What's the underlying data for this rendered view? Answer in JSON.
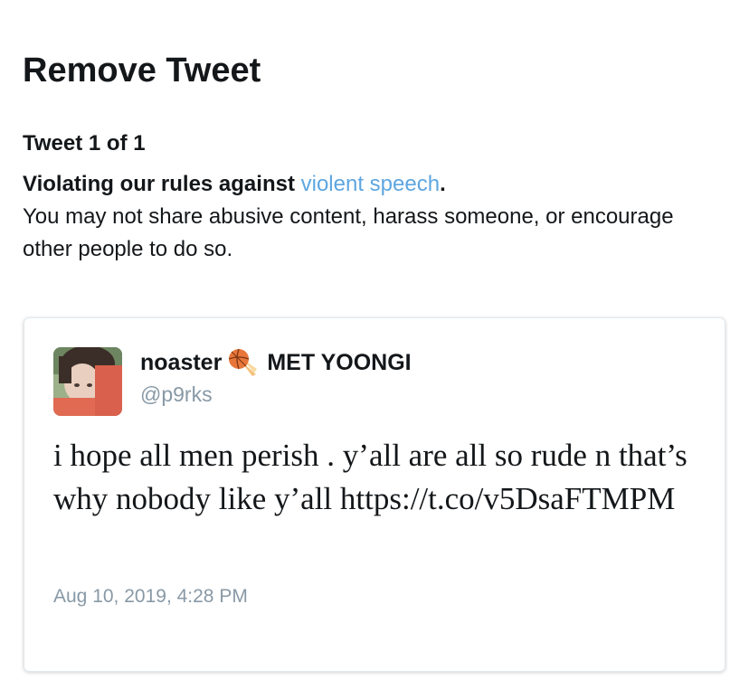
{
  "header": {
    "title": "Remove Tweet"
  },
  "notice": {
    "count": "Tweet 1 of 1",
    "reason_prefix": "Violating our rules against ",
    "reason_link": "violent speech",
    "reason_suffix": ".",
    "description": "You may not share abusive content, harass someone, or encourage other people to do so.",
    "link_color": "#5ea6e0"
  },
  "tweet": {
    "display_name": "noaster",
    "emoji": "basketball-comet-emoji",
    "name_suffix": "MET YOONGI",
    "handle": "@p9rks",
    "text": "i hope all men perish . y’all are all so rude n that’s why nobody like y’all https://t.co/v5DsaFTMPM",
    "timestamp": "Aug 10, 2019, 4:28 PM"
  }
}
